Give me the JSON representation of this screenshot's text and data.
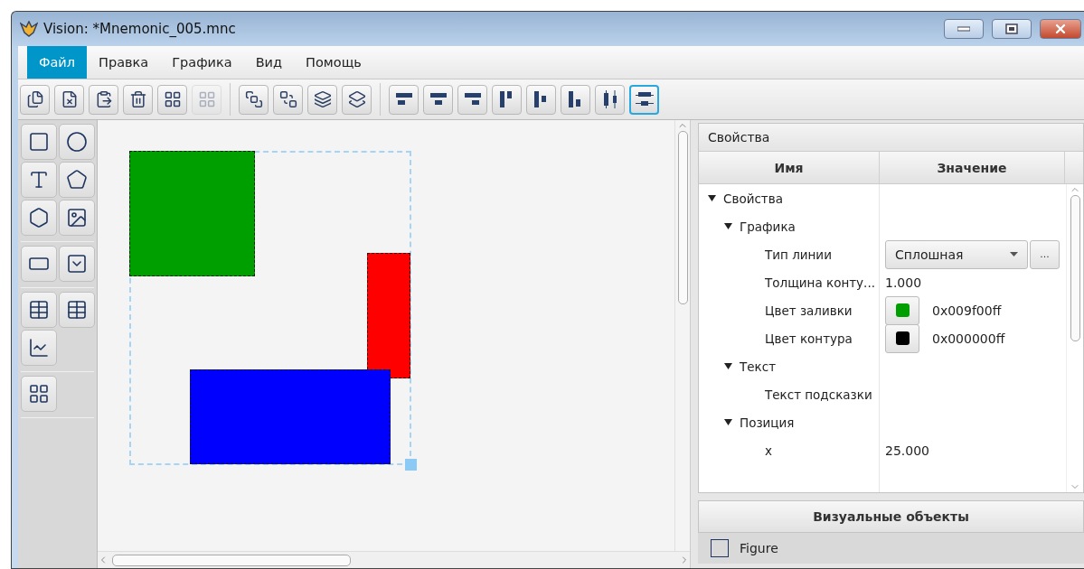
{
  "window": {
    "title": "Vision: *Mnemonic_005.mnc"
  },
  "menu": [
    {
      "label": "Файл",
      "selected": true
    },
    {
      "label": "Правка",
      "selected": false
    },
    {
      "label": "Графика",
      "selected": false
    },
    {
      "label": "Вид",
      "selected": false
    },
    {
      "label": "Помощь",
      "selected": false
    }
  ],
  "toolbar": [
    {
      "disabled": false,
      "selected": false
    },
    {
      "disabled": false,
      "selected": false
    },
    {
      "disabled": false,
      "selected": false
    },
    {
      "disabled": false,
      "selected": false
    },
    {
      "disabled": false,
      "selected": false
    },
    {
      "disabled": true,
      "selected": false
    },
    {
      "disabled": false,
      "selected": false
    },
    {
      "disabled": false,
      "selected": false
    },
    {
      "disabled": false,
      "selected": false
    },
    {
      "disabled": false,
      "selected": false
    },
    {
      "disabled": false,
      "selected": false
    },
    {
      "disabled": false,
      "selected": false
    },
    {
      "disabled": false,
      "selected": false
    },
    {
      "disabled": false,
      "selected": false
    },
    {
      "disabled": false,
      "selected": false
    },
    {
      "disabled": false,
      "selected": false
    },
    {
      "disabled": false,
      "selected": false
    },
    {
      "disabled": false,
      "selected": true
    }
  ],
  "canvas": {
    "shapes": [
      {
        "kind": "rect",
        "color": "#009f00"
      },
      {
        "kind": "rect",
        "color": "#ff0000"
      },
      {
        "kind": "rect",
        "color": "#0000ff"
      }
    ]
  },
  "properties": {
    "title": "Свойства",
    "columns": [
      "Имя",
      "Значение"
    ],
    "tree": [
      {
        "name": "Свойства",
        "expanded": true,
        "children": [
          {
            "name": "Графика",
            "expanded": true,
            "children": [
              {
                "name": "Тип линии",
                "kind": "dropdown",
                "value": "Сплошная",
                "button": "..."
              },
              {
                "name": "Толщина конту...",
                "kind": "text",
                "value": "1.000"
              },
              {
                "name": "Цвет заливки",
                "kind": "color",
                "color": "#009f00",
                "value": "0x009f00ff"
              },
              {
                "name": "Цвет контура",
                "kind": "color",
                "color": "#000000",
                "value": "0x000000ff"
              }
            ]
          },
          {
            "name": "Текст",
            "expanded": true,
            "children": [
              {
                "name": "Текст подсказки",
                "kind": "text"
              }
            ]
          },
          {
            "name": "Позиция",
            "expanded": true,
            "children": [
              {
                "name": "x",
                "kind": "text",
                "value": "25.000"
              }
            ]
          }
        ]
      }
    ]
  },
  "objects": {
    "title": "Визуальные объекты",
    "items": [
      {
        "label": "Figure"
      }
    ]
  }
}
